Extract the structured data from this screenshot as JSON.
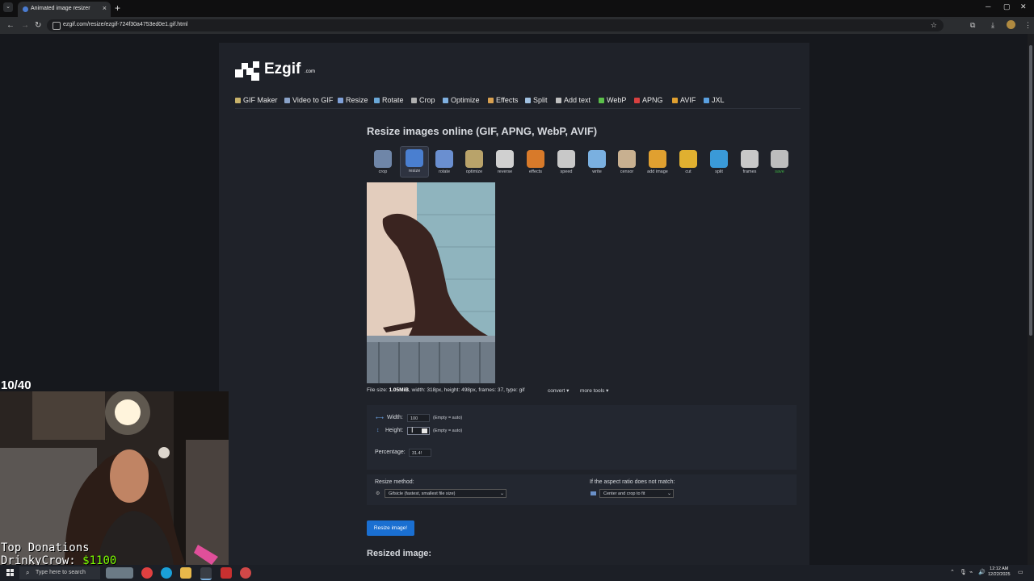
{
  "browser": {
    "tab_title": "Animated image resizer",
    "tab_close": "×",
    "new_tab": "+",
    "url": "ezgif.com/resize/ezgif-724f30a4753ed0e1.gif.html"
  },
  "site": {
    "logo_text": "Ezgif",
    "logo_suffix": ".com"
  },
  "nav": [
    {
      "label": "GIF Maker",
      "color": "#c7b26a"
    },
    {
      "label": "Video to GIF",
      "color": "#8aa2c8"
    },
    {
      "label": "Resize",
      "color": "#7fa0d8"
    },
    {
      "label": "Rotate",
      "color": "#6aa8d8"
    },
    {
      "label": "Crop",
      "color": "#b0b0b0"
    },
    {
      "label": "Optimize",
      "color": "#7fb0e0"
    },
    {
      "label": "Effects",
      "color": "#d8a050"
    },
    {
      "label": "Split",
      "color": "#a0c0e0"
    },
    {
      "label": "Add text",
      "color": "#c0c0c0"
    },
    {
      "label": "WebP",
      "color": "#5bbf4a"
    },
    {
      "label": "APNG",
      "color": "#d84040"
    },
    {
      "label": "AVIF",
      "color": "#e0a030"
    },
    {
      "label": "JXL",
      "color": "#5aa0e0"
    }
  ],
  "page_title": "Resize images online (GIF, APNG, WebP, AVIF)",
  "tools": [
    {
      "label": "crop",
      "color": "#6f86a8"
    },
    {
      "label": "resize",
      "color": "#4a7fd0"
    },
    {
      "label": "rotate",
      "color": "#6a8fd0"
    },
    {
      "label": "optimize",
      "color": "#b9a36a"
    },
    {
      "label": "reverse",
      "color": "#d0d0d0"
    },
    {
      "label": "effects",
      "color": "#d87a2a"
    },
    {
      "label": "speed",
      "color": "#c8c8c8"
    },
    {
      "label": "write",
      "color": "#7ab0e0"
    },
    {
      "label": "censor",
      "color": "#c8b090"
    },
    {
      "label": "add image",
      "color": "#e0a030"
    },
    {
      "label": "cut",
      "color": "#e0b030"
    },
    {
      "label": "split",
      "color": "#3a9ad8"
    },
    {
      "label": "frames",
      "color": "#c8c8c8"
    },
    {
      "label": "save",
      "color": "#bdbdbd"
    }
  ],
  "file_info": {
    "prefix": "File size: ",
    "size": "1.05MiB",
    "rest": ", width: 318px, height: 498px, frames: 37, type: gif",
    "convert": "convert ▾",
    "more_tools": "more tools ▾"
  },
  "form": {
    "width_label": "Width:",
    "width_value": "100",
    "height_label": "Height:",
    "height_value": "",
    "empty_auto": "(Empty = auto)",
    "percentage_label": "Percentage:",
    "percentage_value": "31.4!",
    "method_label": "Resize method:",
    "method_value": "Gifsicle (fastest, smallest file size)",
    "aspect_label": "If the aspect ratio does not match:",
    "aspect_value": "Center and crop to fit",
    "submit": "Resize image!",
    "resized_heading": "Resized image:"
  },
  "overlay": {
    "counter": "10/40",
    "donation_title": "Top Donations",
    "donation_name": "DrinkyCrow: ",
    "donation_value": "$1100"
  },
  "taskbar": {
    "search_placeholder": "Type here to search",
    "time": "12:12 AM",
    "date": "12/22/2025"
  }
}
